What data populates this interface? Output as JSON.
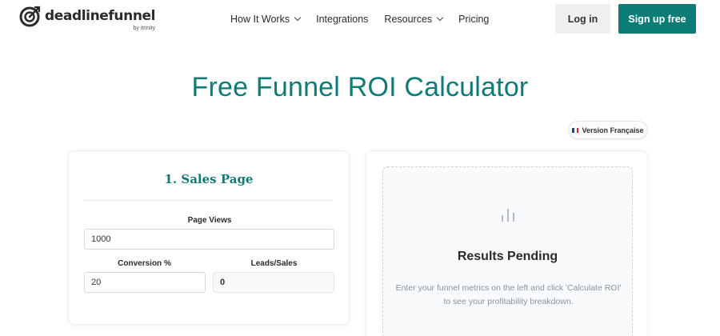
{
  "header": {
    "logo_name": "deadlinefunnel",
    "logo_sub": "by itrinity",
    "nav": [
      {
        "label": "How It Works",
        "has_dropdown": true
      },
      {
        "label": "Integrations",
        "has_dropdown": false
      },
      {
        "label": "Resources",
        "has_dropdown": true
      },
      {
        "label": "Pricing",
        "has_dropdown": false
      }
    ],
    "login_label": "Log in",
    "signup_label": "Sign up free"
  },
  "page": {
    "title": "Free Funnel ROI Calculator",
    "language_toggle": "Version Française"
  },
  "sales_page": {
    "title": "1. Sales Page",
    "page_views_label": "Page Views",
    "page_views_value": "1000",
    "conversion_label": "Conversion %",
    "conversion_value": "20",
    "leads_label": "Leads/Sales",
    "leads_value": "0"
  },
  "results": {
    "title": "Results Pending",
    "message": "Enter your funnel metrics on the left and click 'Calculate ROI' to see your profitability breakdown."
  },
  "colors": {
    "brand": "#0c7c76",
    "title": "#0f7b75",
    "login_bg": "#efefef"
  }
}
